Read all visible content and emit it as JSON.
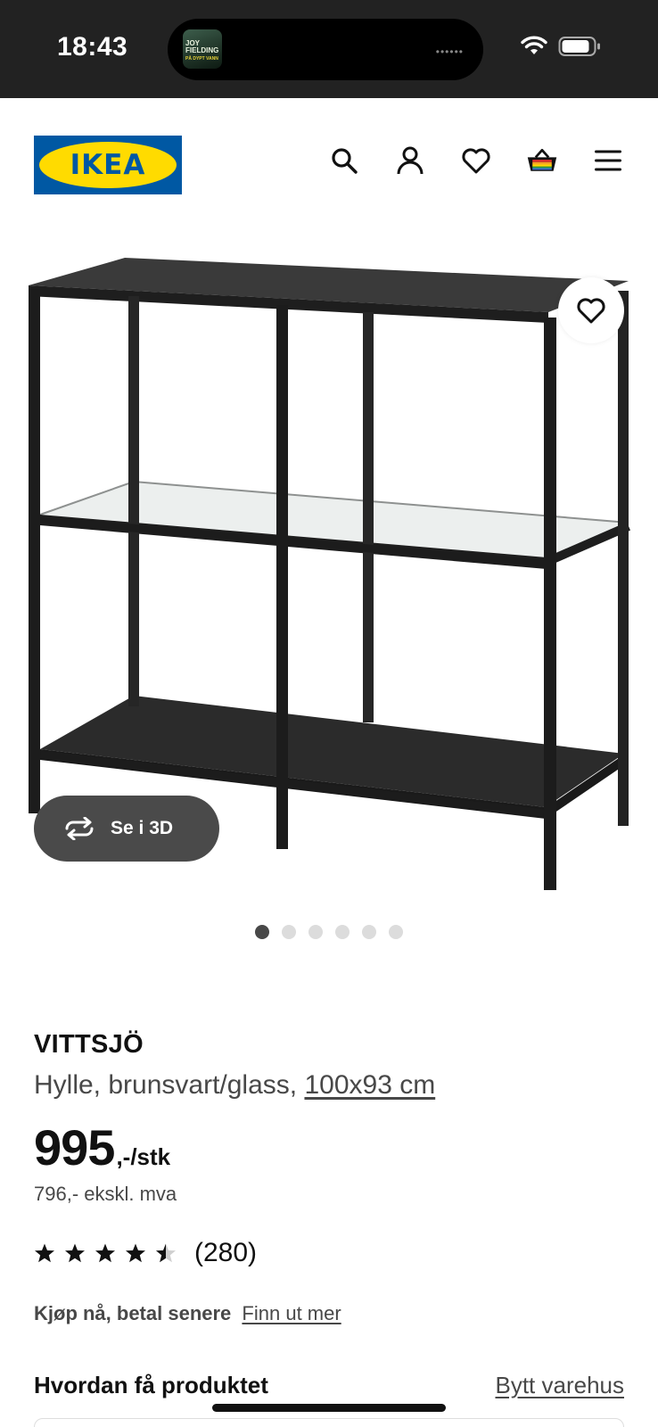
{
  "status_bar": {
    "time": "18:43",
    "now_playing_art_text": "JOY FIELDING",
    "now_playing_art_subtext": "PÅ DYPT VANN"
  },
  "header": {
    "logo_text": "IKEA",
    "icons": [
      "search-icon",
      "account-icon",
      "heart-icon",
      "basket-icon",
      "menu-icon"
    ]
  },
  "gallery": {
    "view_3d_label": "Se i 3D",
    "image_count": 6,
    "active_index": 0
  },
  "product": {
    "name": "VITTSJÖ",
    "description": "Hylle, brunsvart/glass,",
    "size": "100x93 cm",
    "price": "995",
    "price_suffix": ",-/stk",
    "price_ex_vat": "796,- ekskl. mva",
    "rating": 4.5,
    "rating_max": 5,
    "review_count": "(280)"
  },
  "payment": {
    "text": "Kjøp nå, betal senere",
    "link": "Finn ut mer"
  },
  "delivery": {
    "title": "Hvordan få produktet",
    "change_store": "Bytt varehus"
  },
  "colors": {
    "ikea_blue": "#0058a3",
    "ikea_yellow": "#ffdb00",
    "text_primary": "#111111",
    "text_secondary": "#484848"
  }
}
